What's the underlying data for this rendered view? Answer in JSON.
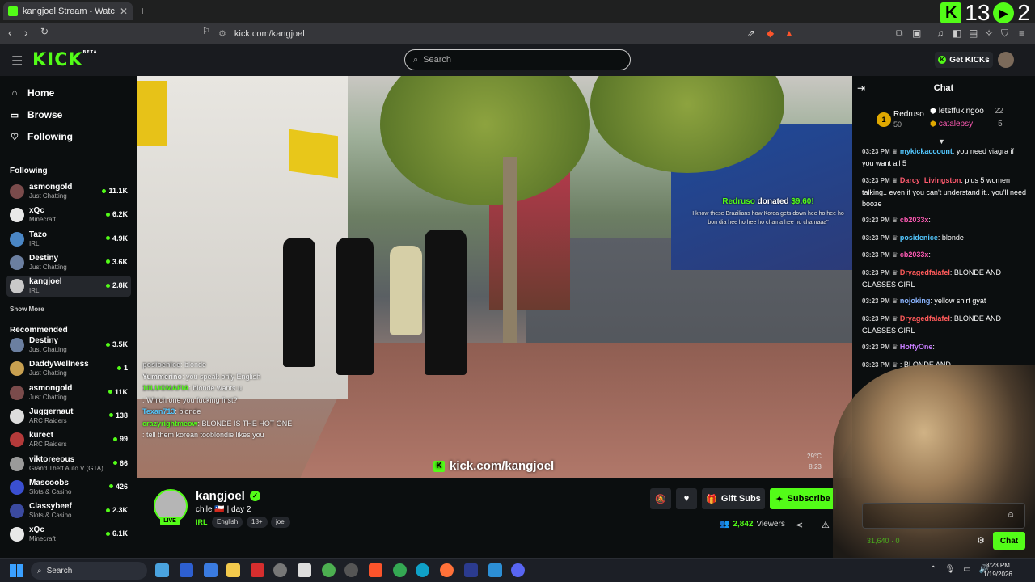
{
  "browser": {
    "tab_title": "kangjoel Stream - Watch Live",
    "new_tab": "+",
    "url_text": "kick.com/kangjoel",
    "counter_a": "13",
    "counter_b": "2"
  },
  "header": {
    "logo": "KICK",
    "logo_badge": "BETA",
    "search_placeholder": "Search",
    "get_kicks": "Get KICKs"
  },
  "sidebar": {
    "nav": [
      {
        "label": "Home",
        "icon": "home-icon"
      },
      {
        "label": "Browse",
        "icon": "browse-icon"
      },
      {
        "label": "Following",
        "icon": "heart-icon"
      }
    ],
    "following_title": "Following",
    "following": [
      {
        "name": "asmongold",
        "category": "Just Chatting",
        "viewers": "11.1K",
        "color": "#7a4b4b"
      },
      {
        "name": "xQc",
        "category": "Minecraft",
        "viewers": "6.2K",
        "color": "#e8e8e8"
      },
      {
        "name": "Tazo",
        "category": "IRL",
        "viewers": "4.9K",
        "color": "#4a86c5"
      },
      {
        "name": "Destiny",
        "category": "Just Chatting",
        "viewers": "3.6K",
        "color": "#6b7fa0"
      },
      {
        "name": "kangjoel",
        "category": "IRL",
        "viewers": "2.8K",
        "color": "#c9c9c9"
      }
    ],
    "show_more": "Show More",
    "recommended_title": "Recommended",
    "recommended": [
      {
        "name": "Destiny",
        "category": "Just Chatting",
        "viewers": "3.5K",
        "color": "#6b7fa0"
      },
      {
        "name": "DaddyWellness",
        "category": "Just Chatting",
        "viewers": "1",
        "color": "#c8a050"
      },
      {
        "name": "asmongold",
        "category": "Just Chatting",
        "viewers": "11K",
        "color": "#7a4b4b"
      },
      {
        "name": "Juggernaut",
        "category": "ARC Raiders",
        "viewers": "138",
        "color": "#dddddd"
      },
      {
        "name": "kurect",
        "category": "ARC Raiders",
        "viewers": "99",
        "color": "#b43a3a"
      },
      {
        "name": "viktoreeous",
        "category": "Grand Theft Auto V (GTA)",
        "viewers": "66",
        "color": "#9a9a9a"
      },
      {
        "name": "Mascoobs",
        "category": "Slots & Casino",
        "viewers": "426",
        "color": "#3a4fd0"
      },
      {
        "name": "Classybeef",
        "category": "Slots & Casino",
        "viewers": "2.3K",
        "color": "#3b4aa0"
      },
      {
        "name": "xQc",
        "category": "Minecraft",
        "viewers": "6.1K",
        "color": "#e8e8e8"
      }
    ]
  },
  "video": {
    "donation_user": "Redruso",
    "donation_text": "donated",
    "donation_amount": "$9.60!",
    "donation_msg": "I know these Brazilians how Korea gets down hee ho hee ho bon dia hee ho hee ho chama hee ho chamaaa\"",
    "overlay_chat": [
      {
        "user": "posioenice",
        "text": ": blonde",
        "color": "#cfcfcf"
      },
      {
        "user": "Yummerino",
        "text": ": you speak only English",
        "color": "#eee"
      },
      {
        "user": "10LUGMAFIA",
        "text": ": blonde wants u",
        "color": "#53fc18"
      },
      {
        "user": "",
        "text": ": Which one you fucking first?",
        "color": "#8ab4ff"
      },
      {
        "user": "Texan713",
        "text": ": blonde",
        "color": "#53c8ff"
      },
      {
        "user": "crazyrightmeow",
        "text": ": BLONDE IS THE HOT ONE",
        "color": "#53fc18"
      },
      {
        "user": "",
        "text": ": tell them korean tooblondie likes you",
        "color": "#8ab4ff"
      }
    ],
    "watermark": "kick.com/kangjoel",
    "temp": "29°C",
    "time": "8:23"
  },
  "stream": {
    "name": "kangjoel",
    "live": "LIVE",
    "title": "chile 🇨🇱 | day 2",
    "category": "IRL",
    "tags": [
      "English",
      "18+",
      "joel"
    ],
    "gift_subs": "Gift Subs",
    "subscribe": "Subscribe",
    "viewers": "2,842",
    "viewers_label": "Viewers"
  },
  "chat": {
    "title": "Chat",
    "leaders": [
      {
        "rank": "1",
        "name": "Redruso",
        "value": "50"
      },
      {
        "name": "letsffukingoo",
        "value": "22"
      },
      {
        "name": "catalepsy",
        "value": "5"
      }
    ],
    "messages": [
      {
        "time": "03:23 PM",
        "user": "mykickaccount",
        "text": ": you need viagra if you want all 5",
        "color": "#53c8ff"
      },
      {
        "time": "03:23 PM",
        "user": "Darcy_Livingston",
        "text": ": plus 5 women talking.. even if you can't understand it.. you'll need booze",
        "color": "#ff5a6e"
      },
      {
        "time": "03:23 PM",
        "user": "cb2033x",
        "text": ":",
        "color": "#ff5ab4"
      },
      {
        "time": "03:23 PM",
        "user": "posidenice",
        "text": ": blonde",
        "color": "#53c8ff"
      },
      {
        "time": "03:23 PM",
        "user": "cb2033x",
        "text": ":",
        "color": "#ff5ab4"
      },
      {
        "time": "03:23 PM",
        "user": "Dryagedfalafel",
        "text": ": BLONDE AND GLASSES GIRL",
        "color": "#ff5a5a"
      },
      {
        "time": "03:23 PM",
        "user": "nojoking",
        "text": ": yellow shirt gyat",
        "color": "#8ab4ff"
      },
      {
        "time": "03:23 PM",
        "user": "Dryagedfalafel",
        "text": ": BLONDE AND GLASSES GIRL",
        "color": "#ff5a5a"
      },
      {
        "time": "03:23 PM",
        "user": "HoffyOne",
        "text": ":",
        "color": "#c77dff"
      },
      {
        "time": "03:23 PM",
        "user": "",
        "text": ": BLONDE AND",
        "color": "#ff5a5a"
      }
    ],
    "chat_button": "Chat",
    "points": "31,640",
    "points_b": "0"
  },
  "taskbar": {
    "search": "Search",
    "time": "3:23 PM",
    "date": "1/19/2026"
  }
}
